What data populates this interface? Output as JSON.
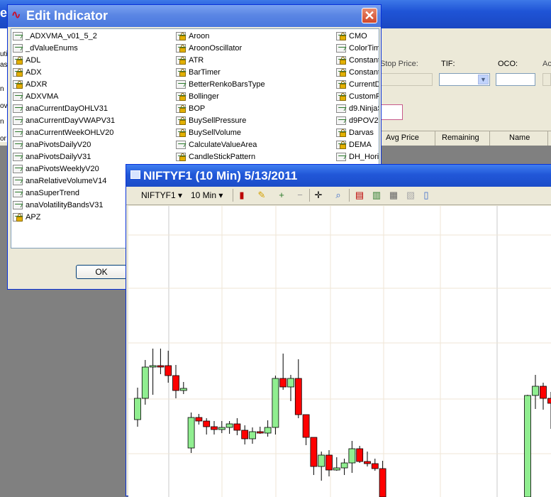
{
  "bg_window": {
    "title_fragment": "e",
    "left_strip": [
      "uti",
      "as",
      "n",
      "ov",
      "n",
      "or"
    ],
    "labels": {
      "stop_price": "Stop Price:",
      "tif": "TIF:",
      "oco": "OCO:",
      "ac": "Ac"
    },
    "grid_headers": [
      "Avg Price",
      "Remaining",
      "Name"
    ]
  },
  "dialog": {
    "title": "Edit Indicator",
    "close_glyph": "✕",
    "ok_label": "OK",
    "columns": [
      [
        {
          "name": "_ADXVMA_v01_5_2",
          "locked": false
        },
        {
          "name": "_dValueEnums",
          "locked": false
        },
        {
          "name": "ADL",
          "locked": true
        },
        {
          "name": "ADX",
          "locked": true
        },
        {
          "name": "ADXR",
          "locked": true
        },
        {
          "name": "ADXVMA",
          "locked": false
        },
        {
          "name": "anaCurrentDayOHLV31",
          "locked": false
        },
        {
          "name": "anaCurrentDayVWAPV31",
          "locked": false
        },
        {
          "name": "anaCurrentWeekOHLV20",
          "locked": false
        },
        {
          "name": "anaPivotsDailyV20",
          "locked": false
        },
        {
          "name": "anaPivotsDailyV31",
          "locked": false
        },
        {
          "name": "anaPivotsWeeklyV20",
          "locked": false
        },
        {
          "name": "anaRelativeVolumeV14",
          "locked": false
        },
        {
          "name": "anaSuperTrend",
          "locked": false
        },
        {
          "name": "anaVolatilityBandsV31",
          "locked": false
        },
        {
          "name": "APZ",
          "locked": true
        }
      ],
      [
        {
          "name": "Aroon",
          "locked": true
        },
        {
          "name": "AroonOscillator",
          "locked": true
        },
        {
          "name": "ATR",
          "locked": true
        },
        {
          "name": "BarTimer",
          "locked": true
        },
        {
          "name": "BetterRenkoBarsType",
          "locked": false
        },
        {
          "name": "Bollinger",
          "locked": true
        },
        {
          "name": "BOP",
          "locked": true
        },
        {
          "name": "BuySellPressure",
          "locked": true
        },
        {
          "name": "BuySellVolume",
          "locked": true
        },
        {
          "name": "CalculateValueArea",
          "locked": false
        },
        {
          "name": "CandleStickPattern",
          "locked": true
        }
      ],
      [
        {
          "name": "CMO",
          "locked": true
        },
        {
          "name": "ColorTime",
          "locked": false
        },
        {
          "name": "Constant",
          "locked": true
        },
        {
          "name": "Constant",
          "locked": true
        },
        {
          "name": "CurrentD",
          "locked": true
        },
        {
          "name": "CustomPl",
          "locked": true
        },
        {
          "name": "d9.NinjaS",
          "locked": false
        },
        {
          "name": "d9POV2",
          "locked": false
        },
        {
          "name": "Darvas",
          "locked": true
        },
        {
          "name": "DEMA",
          "locked": true
        },
        {
          "name": "DH_Horiz",
          "locked": false
        }
      ]
    ]
  },
  "chart_window": {
    "title": "NIFTYF1 (10 Min)  5/13/2011",
    "toolbar": {
      "instrument": "NIFTYF1",
      "interval": "10 Min",
      "dropdown_glyph": "▾"
    }
  },
  "chart_data": {
    "type": "candlestick",
    "colors": {
      "up": "#90ee90",
      "down": "#ff0000",
      "wick": "#000000",
      "grid": "#efe6d6"
    },
    "candles": [
      {
        "o": 590,
        "h": 545,
        "l": 600,
        "c": 560
      },
      {
        "o": 560,
        "h": 506,
        "l": 569,
        "c": 516
      },
      {
        "o": 516,
        "h": 490,
        "l": 555,
        "c": 514
      },
      {
        "o": 514,
        "h": 490,
        "l": 526,
        "c": 514
      },
      {
        "o": 514,
        "h": 493,
        "l": 538,
        "c": 528
      },
      {
        "o": 528,
        "h": 513,
        "l": 560,
        "c": 549
      },
      {
        "o": 549,
        "h": 537,
        "l": 554,
        "c": 546
      },
      {
        "o": 630,
        "h": 580,
        "l": 637,
        "c": 587
      },
      {
        "o": 587,
        "h": 582,
        "l": 597,
        "c": 592
      },
      {
        "o": 592,
        "h": 588,
        "l": 611,
        "c": 600
      },
      {
        "o": 600,
        "h": 592,
        "l": 611,
        "c": 604
      },
      {
        "o": 604,
        "h": 592,
        "l": 609,
        "c": 601
      },
      {
        "o": 601,
        "h": 592,
        "l": 610,
        "c": 596
      },
      {
        "o": 596,
        "h": 588,
        "l": 612,
        "c": 605
      },
      {
        "o": 605,
        "h": 598,
        "l": 625,
        "c": 617
      },
      {
        "o": 617,
        "h": 601,
        "l": 624,
        "c": 607
      },
      {
        "o": 607,
        "h": 600,
        "l": 610,
        "c": 609
      },
      {
        "o": 609,
        "h": 591,
        "l": 614,
        "c": 601
      },
      {
        "o": 601,
        "h": 528,
        "l": 611,
        "c": 532
      },
      {
        "o": 532,
        "h": 497,
        "l": 548,
        "c": 544
      },
      {
        "o": 544,
        "h": 527,
        "l": 564,
        "c": 532
      },
      {
        "o": 532,
        "h": 505,
        "l": 588,
        "c": 583
      },
      {
        "o": 583,
        "h": 592,
        "l": 626,
        "c": 615
      },
      {
        "o": 615,
        "h": 622,
        "l": 668,
        "c": 656
      },
      {
        "o": 656,
        "h": 635,
        "l": 676,
        "c": 640
      },
      {
        "o": 640,
        "h": 633,
        "l": 670,
        "c": 661
      },
      {
        "o": 661,
        "h": 643,
        "l": 662,
        "c": 658
      },
      {
        "o": 658,
        "h": 645,
        "l": 668,
        "c": 651
      },
      {
        "o": 651,
        "h": 620,
        "l": 665,
        "c": 631
      },
      {
        "o": 631,
        "h": 627,
        "l": 651,
        "c": 649
      },
      {
        "o": 649,
        "h": 635,
        "l": 656,
        "c": 652
      },
      {
        "o": 652,
        "h": 645,
        "l": 662,
        "c": 659
      },
      {
        "o": 659,
        "h": 648,
        "l": 699,
        "c": 699
      }
    ],
    "candles_right": [
      {
        "o": 699,
        "h": 555,
        "l": 699,
        "c": 556
      },
      {
        "o": 556,
        "h": 527,
        "l": 575,
        "c": 543
      },
      {
        "o": 543,
        "h": 538,
        "l": 576,
        "c": 560
      },
      {
        "o": 560,
        "h": 551,
        "l": 603,
        "c": 567
      }
    ]
  }
}
